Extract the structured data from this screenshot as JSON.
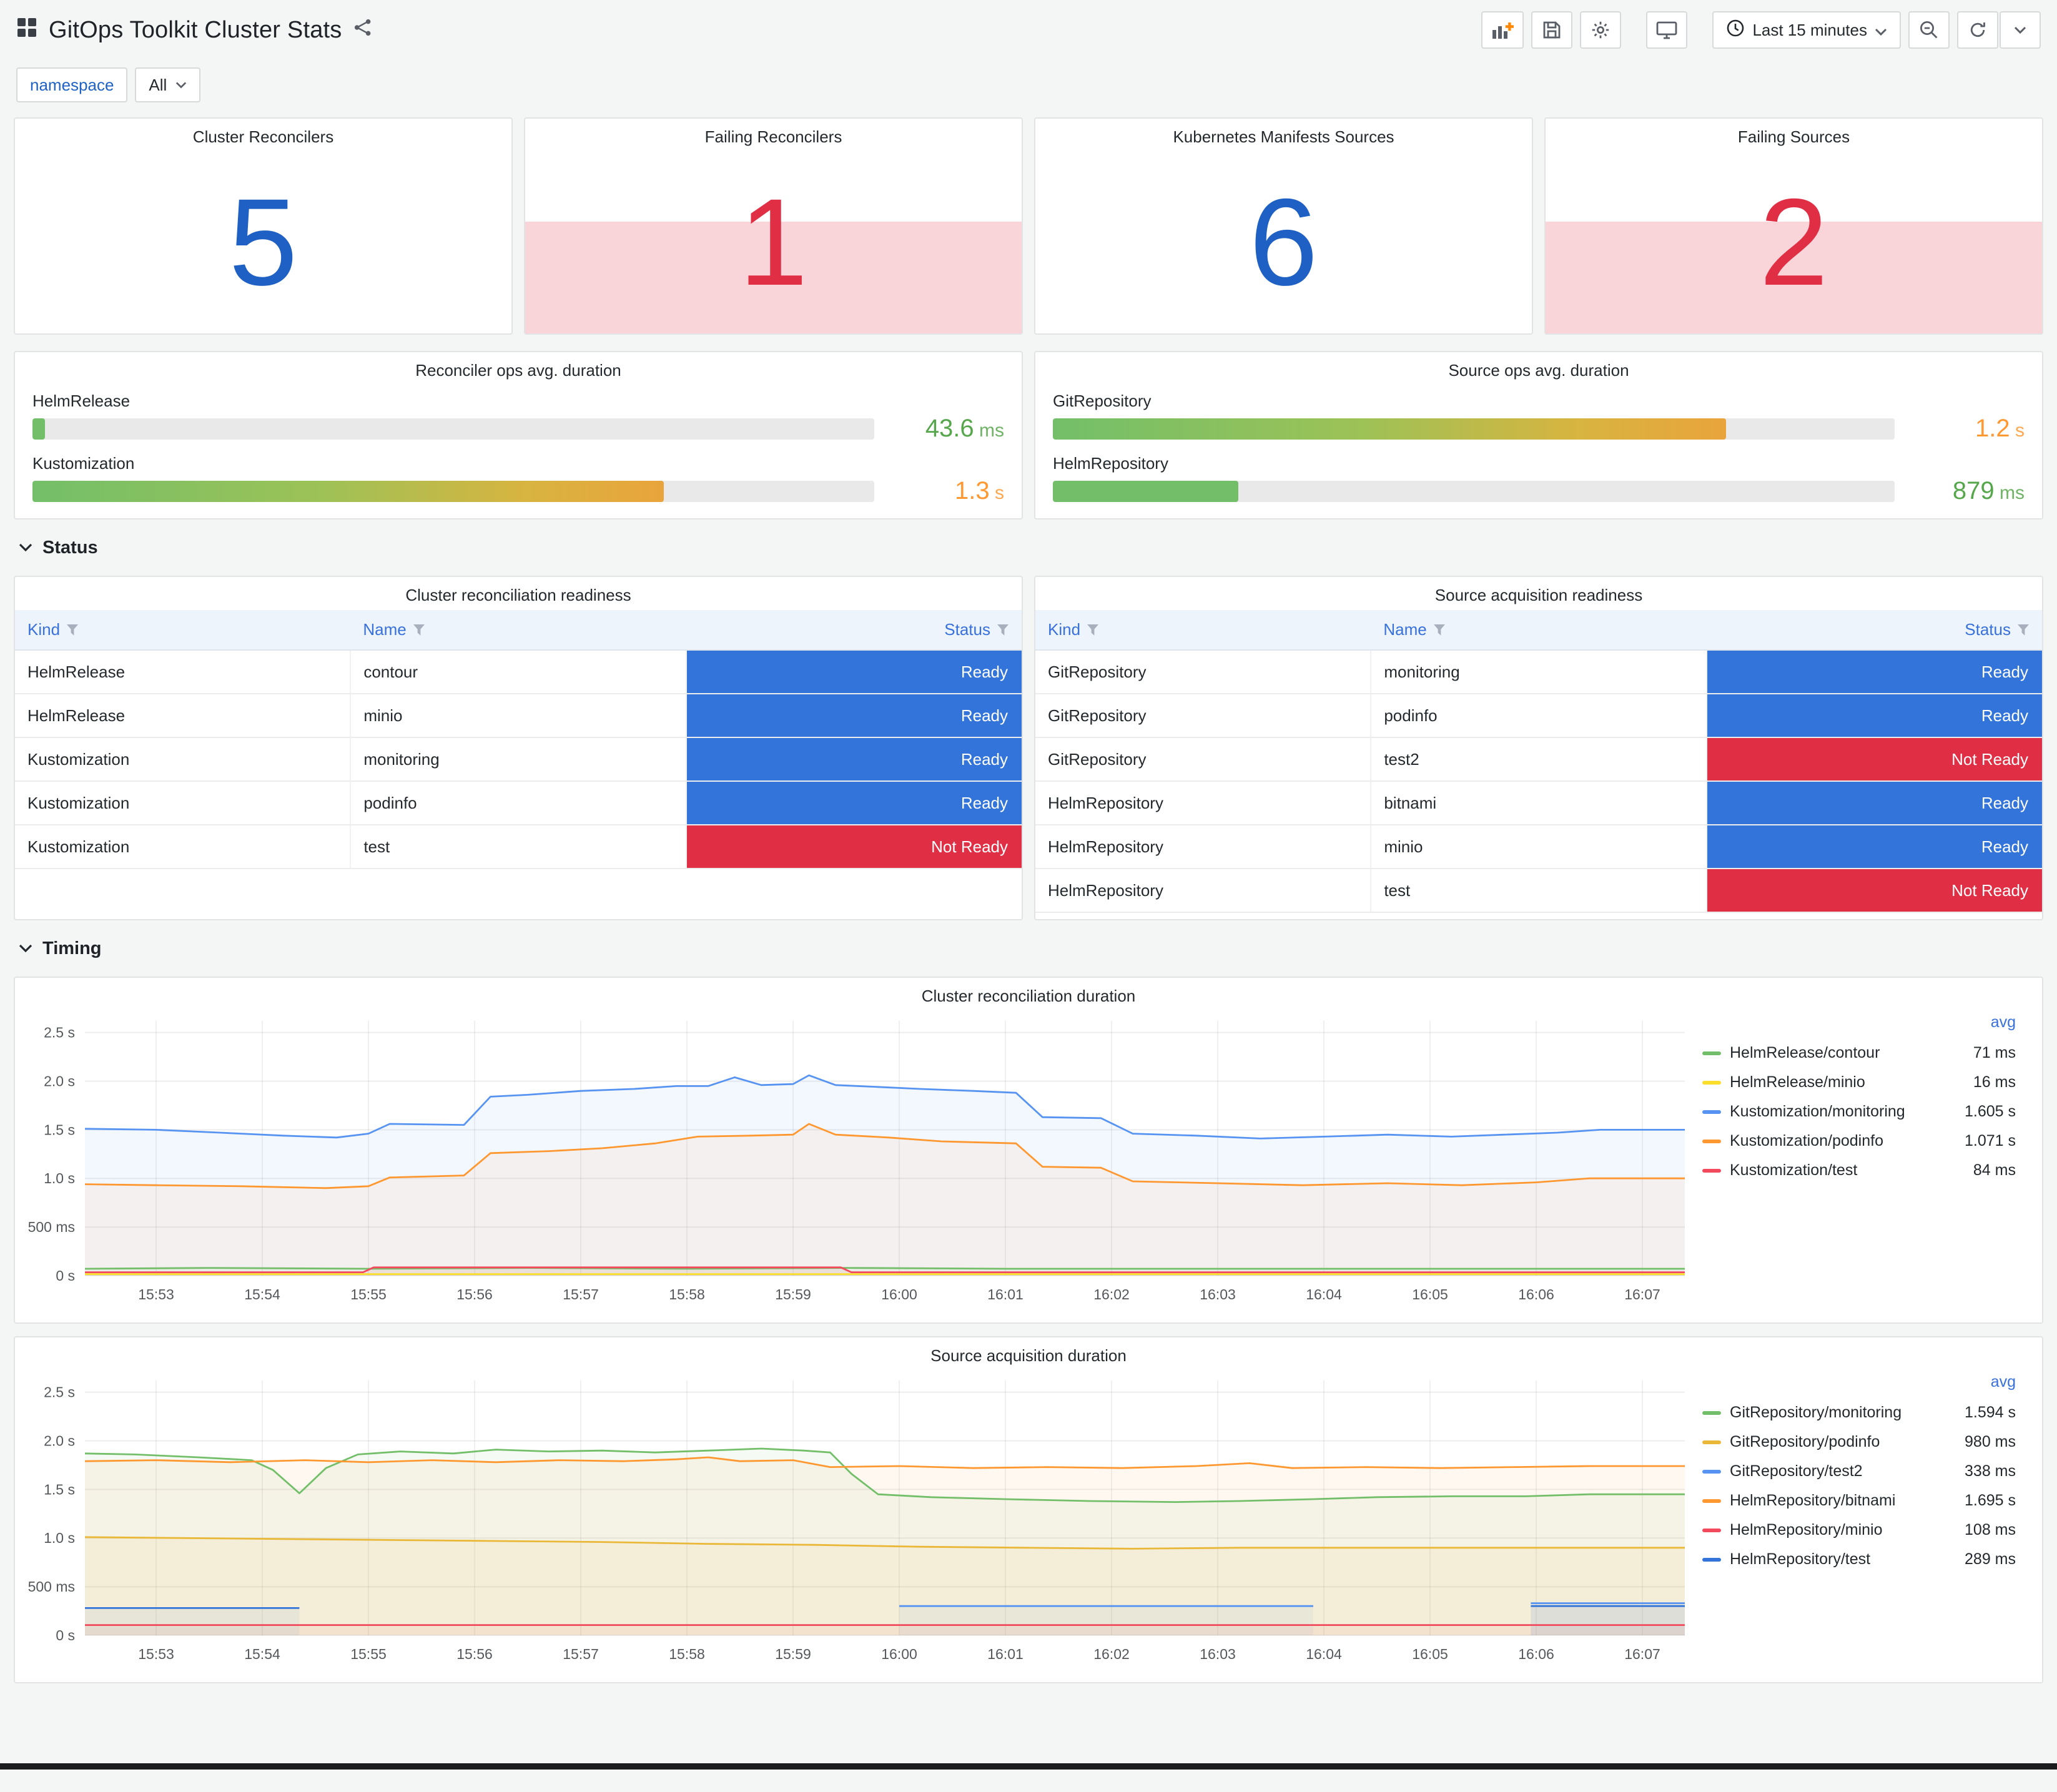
{
  "header": {
    "title": "GitOps Toolkit Cluster Stats",
    "time_range": "Last 15 minutes"
  },
  "filters": {
    "namespace_label": "namespace",
    "namespace_value": "All"
  },
  "sections": {
    "status": "Status",
    "timing": "Timing"
  },
  "colors": {
    "stat_ok": "#1f60c4",
    "stat_alert": "#e02f44",
    "ready": "#3274d9",
    "not_ready": "#e02f44",
    "alert_background": "rgba(224,47,68,0.2)",
    "value_green": "#56a64b",
    "value_orange": "#ff9830"
  },
  "stats": [
    {
      "title": "Cluster Reconcilers",
      "value": "5",
      "state": "ok"
    },
    {
      "title": "Failing Reconcilers",
      "value": "1",
      "state": "alert"
    },
    {
      "title": "Kubernetes Manifests Sources",
      "value": "6",
      "state": "ok"
    },
    {
      "title": "Failing Sources",
      "value": "2",
      "state": "alert"
    }
  ],
  "gauges": [
    {
      "title": "Reconciler ops avg. duration",
      "bars": [
        {
          "label": "HelmRelease",
          "num": "43.6",
          "unit": "ms",
          "pct": 1.5,
          "color": "#56a64b"
        },
        {
          "label": "Kustomization",
          "num": "1.3",
          "unit": "s",
          "pct": 75,
          "color": "#ff9830"
        }
      ]
    },
    {
      "title": "Source ops avg. duration",
      "bars": [
        {
          "label": "GitRepository",
          "num": "1.2",
          "unit": "s",
          "pct": 80,
          "color": "#ff9830"
        },
        {
          "label": "HelmRepository",
          "num": "879",
          "unit": "ms",
          "pct": 22,
          "color": "#56a64b"
        }
      ]
    }
  ],
  "tables": [
    {
      "title": "Cluster reconciliation readiness",
      "columns": [
        "Kind",
        "Name",
        "Status"
      ],
      "rows": [
        [
          "HelmRelease",
          "contour",
          "Ready"
        ],
        [
          "HelmRelease",
          "minio",
          "Ready"
        ],
        [
          "Kustomization",
          "monitoring",
          "Ready"
        ],
        [
          "Kustomization",
          "podinfo",
          "Ready"
        ],
        [
          "Kustomization",
          "test",
          "Not Ready"
        ]
      ]
    },
    {
      "title": "Source acquisition readiness",
      "columns": [
        "Kind",
        "Name",
        "Status"
      ],
      "rows": [
        [
          "GitRepository",
          "monitoring",
          "Ready"
        ],
        [
          "GitRepository",
          "podinfo",
          "Ready"
        ],
        [
          "GitRepository",
          "test2",
          "Not Ready"
        ],
        [
          "HelmRepository",
          "bitnami",
          "Ready"
        ],
        [
          "HelmRepository",
          "minio",
          "Ready"
        ],
        [
          "HelmRepository",
          "test",
          "Not Ready"
        ]
      ]
    }
  ],
  "chart_data": [
    {
      "type": "line",
      "title": "Cluster reconciliation duration",
      "legend_header": "avg",
      "legend_position": "right",
      "grid": true,
      "x_ticks": [
        "15:53",
        "15:54",
        "15:55",
        "15:56",
        "15:57",
        "15:58",
        "15:59",
        "16:00",
        "16:01",
        "16:02",
        "16:03",
        "16:04",
        "16:05",
        "16:06",
        "16:07"
      ],
      "x_tick_values": [
        1,
        2,
        3,
        4,
        5,
        6,
        7,
        8,
        9,
        10,
        11,
        12,
        13,
        14,
        15
      ],
      "x_domain": [
        0.33,
        15.4
      ],
      "y_ticks": [
        "0 s",
        "500 ms",
        "1.0 s",
        "1.5 s",
        "2.0 s",
        "2.5 s"
      ],
      "y_tick_values": [
        0,
        0.5,
        1.0,
        1.5,
        2.0,
        2.5
      ],
      "ylim": [
        0,
        2.62
      ],
      "y_unit": "seconds",
      "series": [
        {
          "name": "HelmRelease/contour",
          "avg": "71 ms",
          "color": "#73bf69",
          "points": [
            [
              0.33,
              0.07
            ],
            [
              1.5,
              0.08
            ],
            [
              3,
              0.07
            ],
            [
              4.5,
              0.08
            ],
            [
              6,
              0.07
            ],
            [
              7.5,
              0.08
            ],
            [
              9,
              0.07
            ],
            [
              10.5,
              0.07
            ],
            [
              12,
              0.07
            ],
            [
              13.5,
              0.07
            ],
            [
              15.4,
              0.07
            ]
          ]
        },
        {
          "name": "HelmRelease/minio",
          "avg": "16 ms",
          "color": "#fade2a",
          "points": [
            [
              0.33,
              0.016
            ],
            [
              15.4,
              0.016
            ]
          ]
        },
        {
          "name": "Kustomization/monitoring",
          "avg": "1.605 s",
          "color": "#5794f2",
          "points": [
            [
              0.33,
              1.51
            ],
            [
              1,
              1.5
            ],
            [
              1.6,
              1.47
            ],
            [
              2.2,
              1.44
            ],
            [
              2.7,
              1.42
            ],
            [
              3.0,
              1.46
            ],
            [
              3.2,
              1.56
            ],
            [
              3.9,
              1.55
            ],
            [
              4.15,
              1.84
            ],
            [
              4.5,
              1.86
            ],
            [
              5.0,
              1.9
            ],
            [
              5.5,
              1.92
            ],
            [
              5.9,
              1.95
            ],
            [
              6.2,
              1.95
            ],
            [
              6.45,
              2.04
            ],
            [
              6.7,
              1.96
            ],
            [
              7.0,
              1.97
            ],
            [
              7.15,
              2.06
            ],
            [
              7.4,
              1.96
            ],
            [
              7.8,
              1.94
            ],
            [
              8.2,
              1.92
            ],
            [
              8.7,
              1.9
            ],
            [
              9.1,
              1.88
            ],
            [
              9.35,
              1.63
            ],
            [
              9.9,
              1.62
            ],
            [
              10.2,
              1.46
            ],
            [
              10.8,
              1.44
            ],
            [
              11.4,
              1.41
            ],
            [
              12.0,
              1.43
            ],
            [
              12.6,
              1.45
            ],
            [
              13.2,
              1.43
            ],
            [
              13.7,
              1.45
            ],
            [
              14.2,
              1.47
            ],
            [
              14.6,
              1.5
            ],
            [
              15.4,
              1.5
            ]
          ]
        },
        {
          "name": "Kustomization/podinfo",
          "avg": "1.071 s",
          "color": "#ff9830",
          "points": [
            [
              0.33,
              0.94
            ],
            [
              1,
              0.93
            ],
            [
              1.8,
              0.92
            ],
            [
              2.6,
              0.9
            ],
            [
              3.0,
              0.92
            ],
            [
              3.2,
              1.01
            ],
            [
              3.9,
              1.03
            ],
            [
              4.15,
              1.26
            ],
            [
              4.7,
              1.28
            ],
            [
              5.2,
              1.31
            ],
            [
              5.7,
              1.36
            ],
            [
              6.1,
              1.43
            ],
            [
              6.6,
              1.44
            ],
            [
              7.0,
              1.45
            ],
            [
              7.15,
              1.56
            ],
            [
              7.4,
              1.45
            ],
            [
              7.9,
              1.42
            ],
            [
              8.4,
              1.38
            ],
            [
              9.1,
              1.36
            ],
            [
              9.35,
              1.12
            ],
            [
              9.9,
              1.11
            ],
            [
              10.2,
              0.97
            ],
            [
              11.0,
              0.95
            ],
            [
              11.8,
              0.93
            ],
            [
              12.6,
              0.95
            ],
            [
              13.3,
              0.93
            ],
            [
              14.0,
              0.96
            ],
            [
              14.5,
              1.0
            ],
            [
              15.4,
              1.0
            ]
          ]
        },
        {
          "name": "Kustomization/test",
          "avg": "84 ms",
          "color": "#f2495c",
          "points": [
            [
              0.33,
              0.035
            ],
            [
              2.95,
              0.035
            ],
            [
              3.05,
              0.085
            ],
            [
              7.45,
              0.085
            ],
            [
              7.55,
              0.035
            ],
            [
              15.4,
              0.035
            ]
          ]
        }
      ]
    },
    {
      "type": "line",
      "title": "Source acquisition duration",
      "legend_header": "avg",
      "legend_position": "right",
      "grid": true,
      "x_ticks": [
        "15:53",
        "15:54",
        "15:55",
        "15:56",
        "15:57",
        "15:58",
        "15:59",
        "16:00",
        "16:01",
        "16:02",
        "16:03",
        "16:04",
        "16:05",
        "16:06",
        "16:07"
      ],
      "x_tick_values": [
        1,
        2,
        3,
        4,
        5,
        6,
        7,
        8,
        9,
        10,
        11,
        12,
        13,
        14,
        15
      ],
      "x_domain": [
        0.33,
        15.4
      ],
      "y_ticks": [
        "0 s",
        "500 ms",
        "1.0 s",
        "1.5 s",
        "2.0 s",
        "2.5 s"
      ],
      "y_tick_values": [
        0,
        0.5,
        1.0,
        1.5,
        2.0,
        2.5
      ],
      "ylim": [
        0,
        2.62
      ],
      "y_unit": "seconds",
      "series": [
        {
          "name": "GitRepository/monitoring",
          "avg": "1.594 s",
          "color": "#73bf69",
          "points": [
            [
              0.33,
              1.87
            ],
            [
              0.8,
              1.86
            ],
            [
              1.4,
              1.83
            ],
            [
              1.9,
              1.8
            ],
            [
              2.1,
              1.7
            ],
            [
              2.35,
              1.46
            ],
            [
              2.6,
              1.72
            ],
            [
              2.9,
              1.86
            ],
            [
              3.3,
              1.89
            ],
            [
              3.8,
              1.87
            ],
            [
              4.2,
              1.91
            ],
            [
              4.7,
              1.89
            ],
            [
              5.2,
              1.9
            ],
            [
              5.7,
              1.88
            ],
            [
              6.2,
              1.9
            ],
            [
              6.7,
              1.92
            ],
            [
              7.1,
              1.9
            ],
            [
              7.35,
              1.88
            ],
            [
              7.55,
              1.66
            ],
            [
              7.8,
              1.45
            ],
            [
              8.3,
              1.42
            ],
            [
              9.0,
              1.4
            ],
            [
              9.8,
              1.38
            ],
            [
              10.6,
              1.37
            ],
            [
              11.2,
              1.38
            ],
            [
              11.9,
              1.4
            ],
            [
              12.5,
              1.42
            ],
            [
              13.2,
              1.43
            ],
            [
              13.9,
              1.43
            ],
            [
              14.5,
              1.45
            ],
            [
              15.4,
              1.45
            ]
          ]
        },
        {
          "name": "GitRepository/podinfo",
          "avg": "980 ms",
          "color": "#eab839",
          "points": [
            [
              0.33,
              1.01
            ],
            [
              1.2,
              1.0
            ],
            [
              2.2,
              0.99
            ],
            [
              3.2,
              0.98
            ],
            [
              4.2,
              0.97
            ],
            [
              5.2,
              0.96
            ],
            [
              6.2,
              0.94
            ],
            [
              7.2,
              0.93
            ],
            [
              8.2,
              0.91
            ],
            [
              9.2,
              0.9
            ],
            [
              10.2,
              0.89
            ],
            [
              11.2,
              0.9
            ],
            [
              12.2,
              0.9
            ],
            [
              13.2,
              0.9
            ],
            [
              14.2,
              0.9
            ],
            [
              15.4,
              0.9
            ]
          ]
        },
        {
          "name": "GitRepository/test2",
          "avg": "338 ms",
          "color": "#5794f2",
          "points": [
            [
              8.0,
              0.3
            ],
            [
              11.9,
              0.3
            ],
            [
              12.0,
              null
            ],
            [
              13.95,
              0.33
            ],
            [
              15.4,
              0.33
            ]
          ]
        },
        {
          "name": "HelmRepository/bitnami",
          "avg": "1.695 s",
          "color": "#ff9830",
          "points": [
            [
              0.33,
              1.79
            ],
            [
              1.0,
              1.8
            ],
            [
              1.7,
              1.78
            ],
            [
              2.4,
              1.8
            ],
            [
              3.0,
              1.78
            ],
            [
              3.6,
              1.8
            ],
            [
              4.2,
              1.78
            ],
            [
              4.8,
              1.8
            ],
            [
              5.4,
              1.79
            ],
            [
              5.9,
              1.81
            ],
            [
              6.2,
              1.83
            ],
            [
              6.5,
              1.79
            ],
            [
              7.0,
              1.8
            ],
            [
              7.35,
              1.73
            ],
            [
              8.0,
              1.74
            ],
            [
              8.7,
              1.72
            ],
            [
              9.4,
              1.73
            ],
            [
              10.1,
              1.72
            ],
            [
              10.8,
              1.74
            ],
            [
              11.3,
              1.77
            ],
            [
              11.7,
              1.72
            ],
            [
              12.4,
              1.73
            ],
            [
              13.1,
              1.72
            ],
            [
              13.8,
              1.73
            ],
            [
              14.5,
              1.74
            ],
            [
              15.4,
              1.74
            ]
          ]
        },
        {
          "name": "HelmRepository/minio",
          "avg": "108 ms",
          "color": "#f2495c",
          "points": [
            [
              0.33,
              0.105
            ],
            [
              15.4,
              0.105
            ]
          ]
        },
        {
          "name": "HelmRepository/test",
          "avg": "289 ms",
          "color": "#3274d9",
          "points": [
            [
              0.33,
              0.28
            ],
            [
              2.35,
              0.28
            ],
            [
              2.4,
              null
            ],
            [
              13.95,
              0.3
            ],
            [
              15.4,
              0.3
            ]
          ]
        }
      ]
    }
  ]
}
